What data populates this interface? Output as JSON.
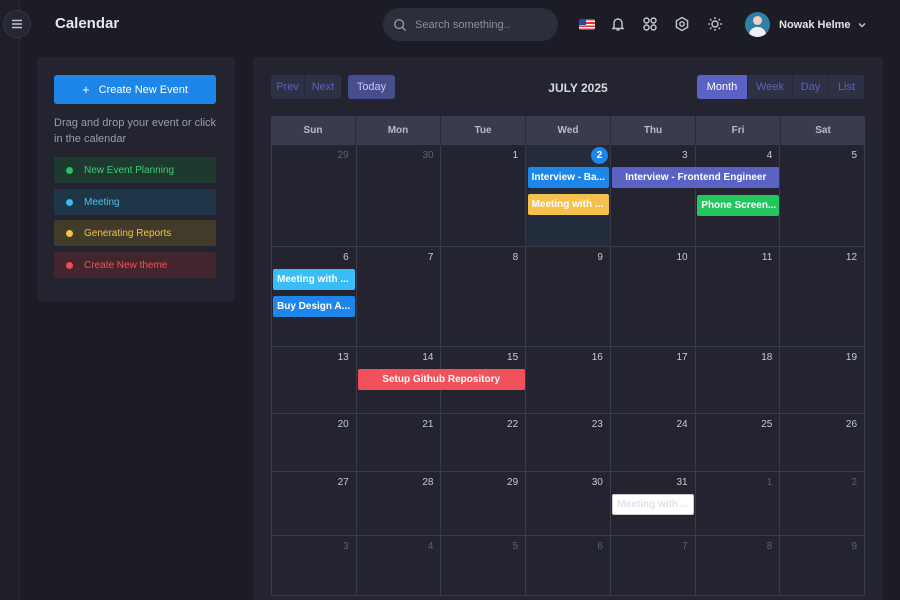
{
  "header": {
    "title": "Calendar",
    "search_placeholder": "Search something..",
    "user_name": "Nowak Helme"
  },
  "sidebar": {
    "create_label": "Create New Event",
    "hint": "Drag and drop your event or click in the calendar",
    "draggable_events": [
      {
        "label": "New Event Planning",
        "color": "#22c55e",
        "bg": "#1e3a2e",
        "fg": "#3ccf76"
      },
      {
        "label": "Meeting",
        "color": "#38bdf8",
        "bg": "#1e3647",
        "fg": "#4cc0f0"
      },
      {
        "label": "Generating Reports",
        "color": "#f5c04b",
        "bg": "#433b2a",
        "fg": "#f0c14e"
      },
      {
        "label": "Create New theme",
        "color": "#ef4d56",
        "bg": "#43262d",
        "fg": "#f0515a"
      }
    ]
  },
  "calendar": {
    "prev_label": "Prev",
    "next_label": "Next",
    "today_label": "Today",
    "month_title": "JULY 2025",
    "views": [
      "Month",
      "Week",
      "Day",
      "List"
    ],
    "active_view": "Month",
    "weekdays": [
      "Sun",
      "Mon",
      "Tue",
      "Wed",
      "Thu",
      "Fri",
      "Sat"
    ],
    "weeks": [
      [
        "29",
        "30",
        "1",
        "2",
        "3",
        "4",
        "5"
      ],
      [
        "6",
        "7",
        "8",
        "9",
        "10",
        "11",
        "12"
      ],
      [
        "13",
        "14",
        "15",
        "16",
        "17",
        "18",
        "19"
      ],
      [
        "20",
        "21",
        "22",
        "23",
        "24",
        "25",
        "26"
      ],
      [
        "27",
        "28",
        "29",
        "30",
        "31",
        "1",
        "2"
      ],
      [
        "3",
        "4",
        "5",
        "6",
        "7",
        "8",
        "9"
      ]
    ],
    "today_date": "2",
    "events": [
      {
        "title": "Interview - Ba...",
        "day": "2",
        "color": "#1e86e8"
      },
      {
        "title": "Meeting with ...",
        "day": "2",
        "color": "#f5c04b"
      },
      {
        "title": "Interview - Frontend Engineer",
        "day": "3",
        "end_day": "4",
        "color": "#5a62c4"
      },
      {
        "title": "Phone Screen...",
        "day": "4",
        "color": "#22c55e"
      },
      {
        "title": "Meeting with ...",
        "day": "6",
        "color": "#38bdf8"
      },
      {
        "title": "Buy Design A...",
        "day": "6",
        "color": "#1e86e8"
      },
      {
        "title": "Setup Github Repository",
        "day": "14",
        "end_day": "15",
        "color": "#f0515a"
      },
      {
        "title": "Meeting with ...",
        "day": "31",
        "color": "#ffffff"
      }
    ]
  }
}
